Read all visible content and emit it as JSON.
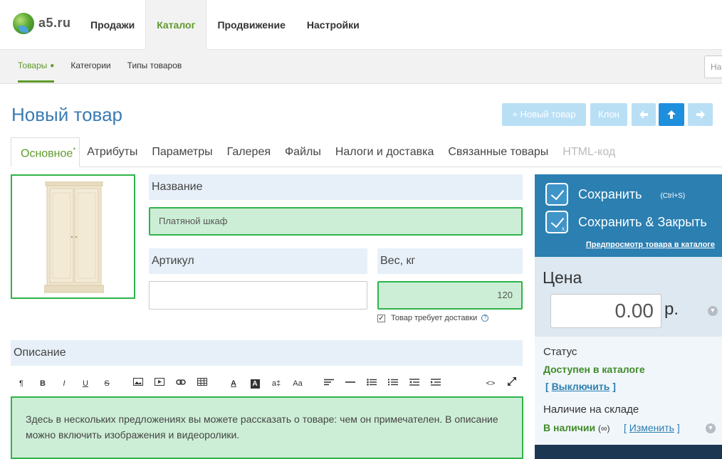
{
  "app": {
    "logo_text": "a5.ru"
  },
  "main_nav": {
    "items": [
      {
        "label": "Продажи"
      },
      {
        "label": "Каталог"
      },
      {
        "label": "Продвижение"
      },
      {
        "label": "Настройки"
      }
    ],
    "active": "Каталог"
  },
  "sub_nav": {
    "items": [
      {
        "label": "Товары"
      },
      {
        "label": "Категории"
      },
      {
        "label": "Типы товаров"
      }
    ],
    "active": "Товары"
  },
  "search": {
    "placeholder": "На"
  },
  "page": {
    "title": "Новый товар"
  },
  "toolbar": {
    "new_product": "Новый товар",
    "clone": "Клон",
    "icons": [
      "arrow-left-icon",
      "arrow-up-icon",
      "arrow-right-icon"
    ]
  },
  "tabs": [
    {
      "label": "Основное",
      "marker": "*"
    },
    {
      "label": "Атрибуты"
    },
    {
      "label": "Параметры"
    },
    {
      "label": "Галерея"
    },
    {
      "label": "Файлы"
    },
    {
      "label": "Налоги и доставка"
    },
    {
      "label": "Связанные товары"
    },
    {
      "label": "HTML-код"
    }
  ],
  "form": {
    "name_label": "Название",
    "name_value": "Платяной шкаф",
    "sku_label": "Артикул",
    "sku_value": "",
    "weight_label": "Вес, кг",
    "weight_value": "120",
    "delivery_label": "Товар требует доставки",
    "delivery_checked": true,
    "description_label": "Описание",
    "description_text": "Здесь в нескольких предложениях вы можете рассказать о товаре: чем он примечателен. В описание можно включить изображения и видеоролики."
  },
  "editor_tools": [
    "paragraph-icon",
    "bold-icon",
    "italic-icon",
    "underline-icon",
    "strikethrough-icon",
    "image-icon",
    "video-icon",
    "link-icon",
    "table-icon",
    "font-color-icon",
    "background-color-icon",
    "font-size-icon",
    "font-case-icon",
    "align-icon",
    "hr-icon",
    "bullet-list-icon",
    "numbered-list-icon",
    "outdent-icon",
    "indent-icon",
    "code-icon",
    "fullscreen-icon"
  ],
  "sidebar": {
    "save": "Сохранить",
    "save_hint": "(Ctrl+S)",
    "save_close": "Сохранить & Закрыть",
    "preview_link": "Предпросмотр товара в каталоге",
    "price_label": "Цена",
    "price_value": "0.00",
    "currency": "р.",
    "status_label": "Статус",
    "status_value": "Доступен в каталоге",
    "status_action": "Выключить",
    "stock_label": "Наличие на складе",
    "stock_value": "В наличии",
    "stock_qty": "(∞)",
    "stock_action": "Изменить"
  },
  "colors": {
    "accent_green": "#5f9a2a",
    "title_blue": "#3a7bb3",
    "panel_blue": "#2b7fb1",
    "valid_green": "#2fb34a"
  }
}
